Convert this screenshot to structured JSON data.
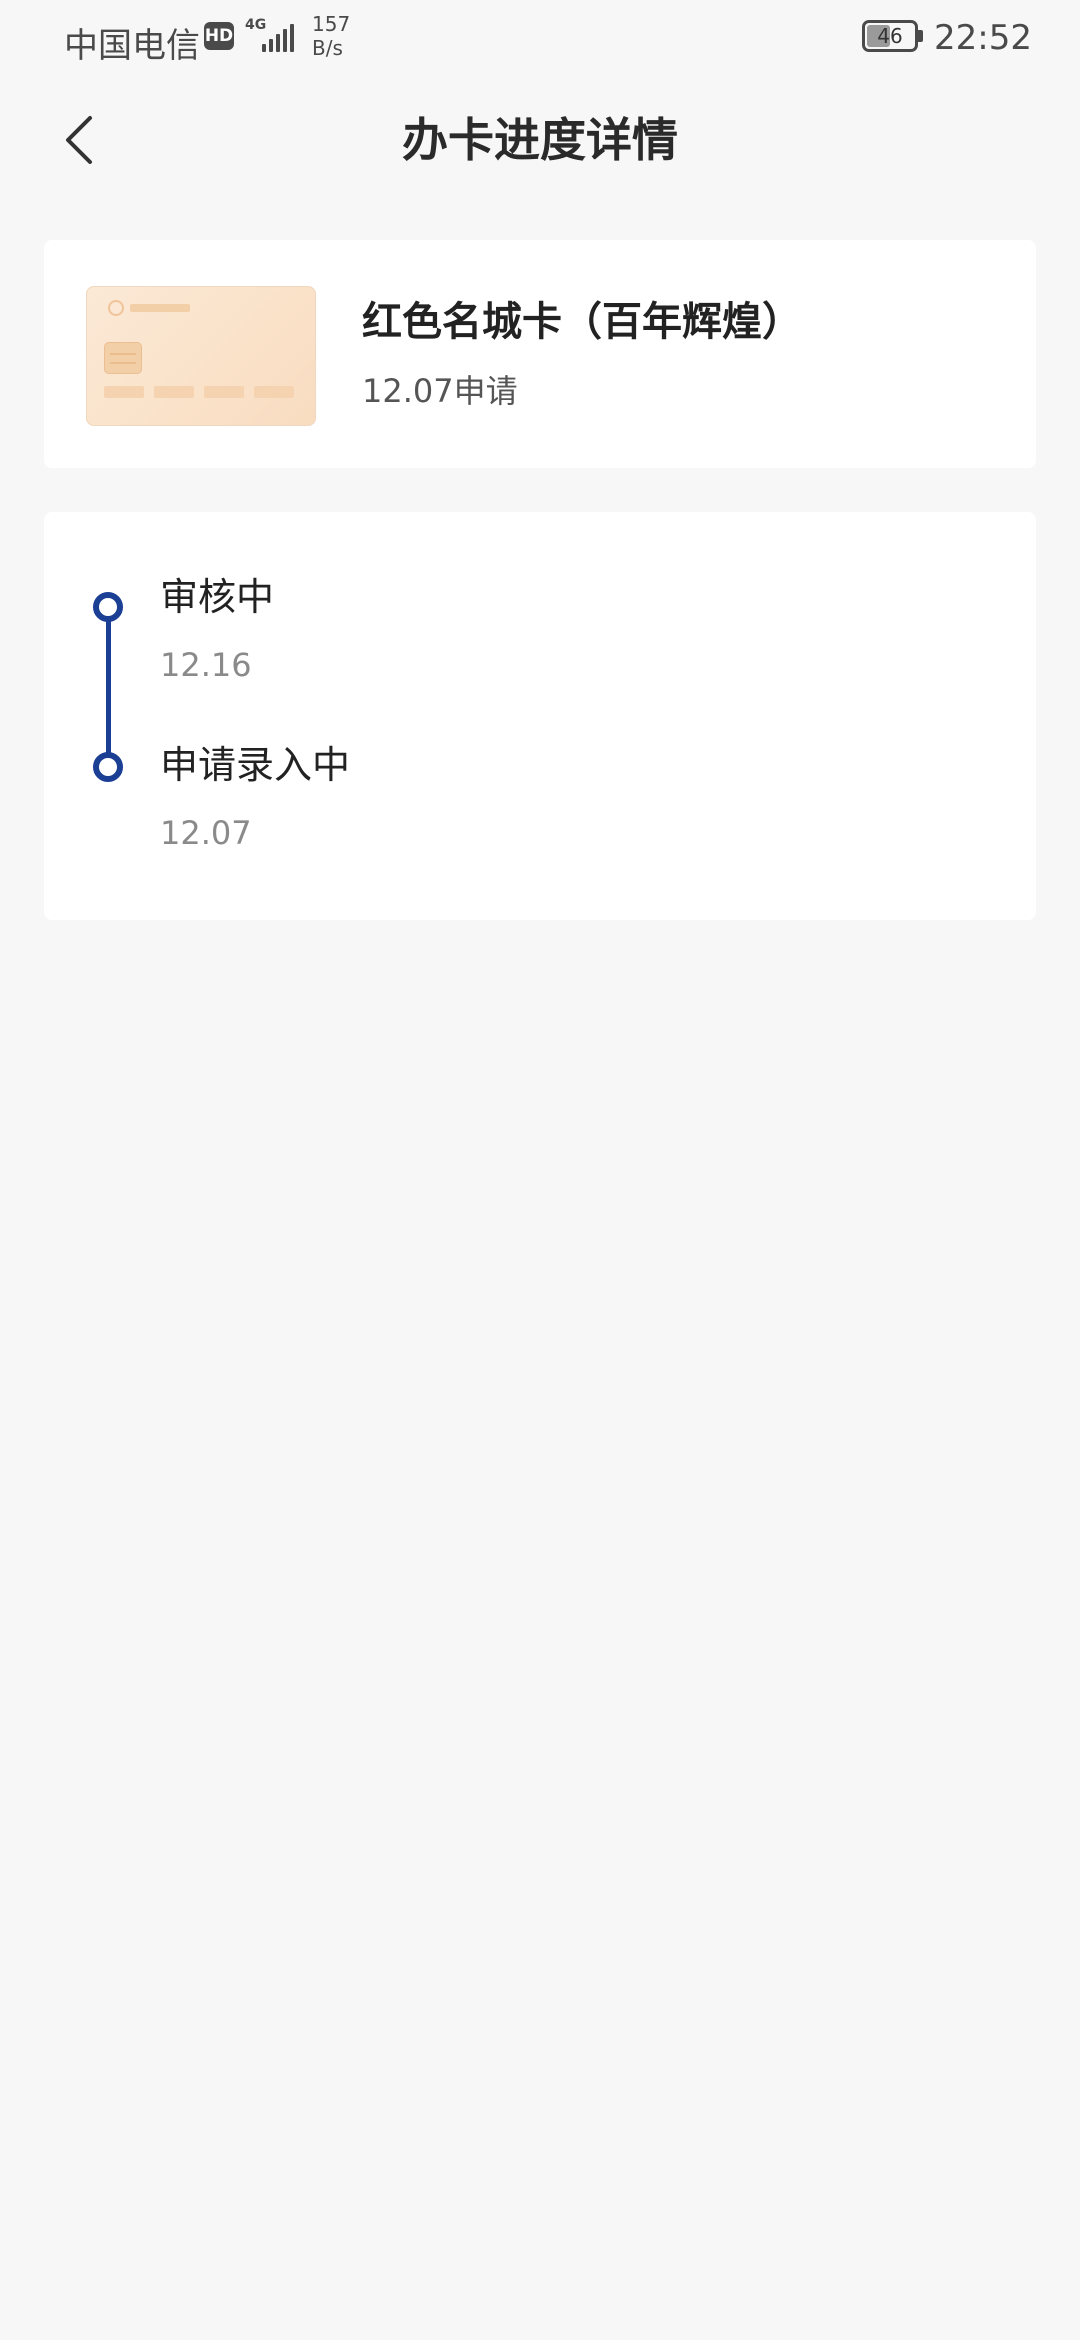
{
  "status_bar": {
    "carrier": "中国电信",
    "hd_badge": "HD",
    "network_type": "4G",
    "net_speed_value": "157",
    "net_speed_unit": "B/s",
    "battery_level": "46",
    "time": "22:52"
  },
  "header": {
    "title": "办卡进度详情",
    "back_icon": "chevron-left-icon"
  },
  "card": {
    "name": "红色名城卡（百年辉煌）",
    "applied_text": "12.07申请",
    "image_colors": [
      "#fbe9d6",
      "#f8dcc0"
    ]
  },
  "progress": {
    "accent_color": "#1b3f95",
    "steps": [
      {
        "title": "审核中",
        "date": "12.16"
      },
      {
        "title": "申请录入中",
        "date": "12.07"
      }
    ]
  }
}
